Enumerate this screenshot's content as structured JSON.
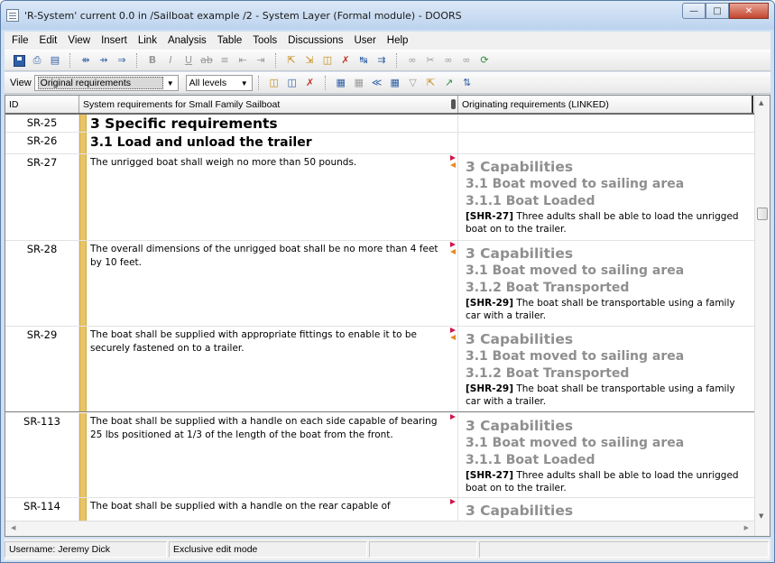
{
  "window": {
    "title": "'R-System' current 0.0 in /Sailboat example /2 - System Layer (Formal module) - DOORS",
    "min_icon": "minimize-icon",
    "max_icon": "maximize-icon",
    "close_icon": "close-icon"
  },
  "menu": [
    "File",
    "Edit",
    "View",
    "Insert",
    "Link",
    "Analysis",
    "Table",
    "Tools",
    "Discussions",
    "User",
    "Help"
  ],
  "toolbar2": {
    "view_label": "View",
    "view_value": "Original requirements",
    "levels_value": "All levels"
  },
  "columns": {
    "id": "ID",
    "main": "System requirements for Small Family Sailboat",
    "orig": "Originating requirements (LINKED)"
  },
  "rows": [
    {
      "id": "SR-25",
      "text": "3 Specific requirements"
    },
    {
      "id": "SR-26",
      "text": "3.1 Load and unload the trailer"
    },
    {
      "id": "SR-27",
      "text": "The unrigged boat shall weigh no more than 50 pounds.",
      "orig": {
        "h1": "3 Capabilities",
        "h2": "3.1 Boat moved to sailing area",
        "h3": "3.1.1 Boat Loaded",
        "ref": "[SHR-27]",
        "txt": " Three adults shall be able to load the unrigged boat on to the trailer."
      }
    },
    {
      "id": "SR-28",
      "text": "The overall dimensions of the unrigged boat shall be no more than 4 feet by 10 feet.",
      "orig": {
        "h1": "3 Capabilities",
        "h2": "3.1 Boat moved to sailing area",
        "h3": "3.1.2 Boat Transported",
        "ref": "[SHR-29]",
        "txt": " The boat shall be transportable using a family car with a trailer."
      }
    },
    {
      "id": "SR-29",
      "text": "The boat shall be supplied with appropriate fittings to enable it to be securely fastened on to a trailer.",
      "orig": {
        "h1": "3 Capabilities",
        "h2": "3.1 Boat moved to sailing area",
        "h3": "3.1.2 Boat Transported",
        "ref": "[SHR-29]",
        "txt": " The boat shall be transportable using a family car with a trailer."
      }
    },
    {
      "id": "SR-113",
      "text": "The boat shall be supplied with a handle on each side capable of bearing 25 lbs positioned at 1/3 of the length of the boat from the front.",
      "orig": {
        "h1": "3 Capabilities",
        "h2": "3.1 Boat moved to sailing area",
        "h3": "3.1.1 Boat Loaded",
        "ref": "[SHR-27]",
        "txt": " Three adults shall be able to load the unrigged boat on to the trailer."
      }
    },
    {
      "id": "SR-114",
      "text": "The boat shall be supplied with a handle on the rear capable of",
      "orig": {
        "h1": "3 Capabilities"
      }
    }
  ],
  "status": {
    "user": "Username: Jeremy Dick",
    "mode": "Exclusive edit mode"
  }
}
